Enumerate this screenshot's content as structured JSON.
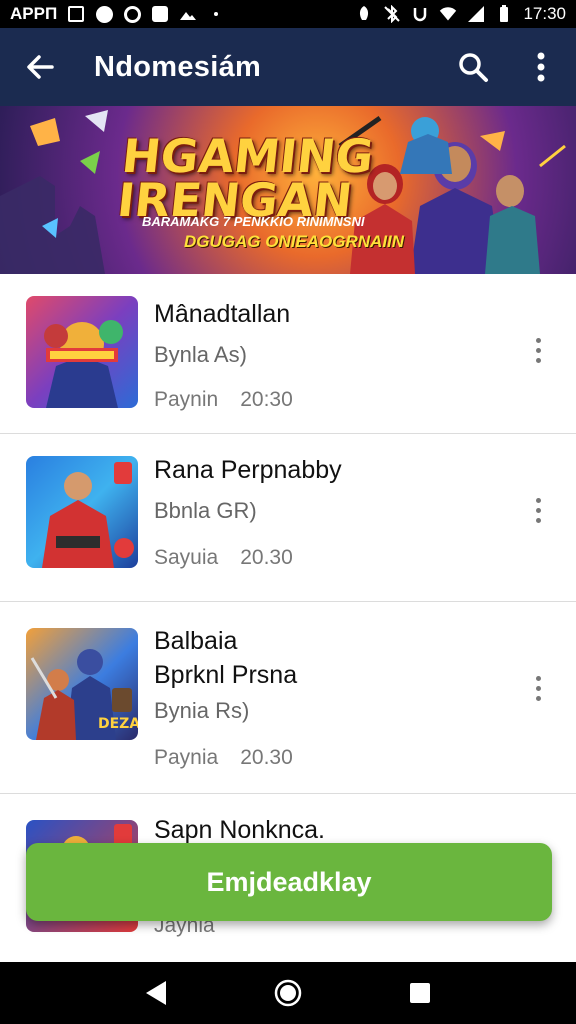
{
  "status_bar": {
    "app_label": "APPΠ",
    "time": "17:30",
    "left_icons": [
      "notification-box-icon",
      "heart-circle-icon",
      "settings-circle-icon",
      "camera-icon",
      "landscape-icon",
      "dot-icon"
    ],
    "right_icons": [
      "alarm-icon",
      "bluetooth-off-icon",
      "battery-saver-icon",
      "wifi-icon",
      "signal-icon",
      "battery-icon"
    ]
  },
  "app_bar": {
    "title": "Ndomesiám",
    "back_icon": "back-arrow-icon",
    "search_icon": "search-icon",
    "more_icon": "more-vert-icon",
    "background": "#1b2b50"
  },
  "banner": {
    "title_line1": "HGAMING",
    "title_line2": "IRENGAN",
    "subtitle1": "BARAMAKG 7 PENKKIO RINIMNSNI",
    "subtitle2": "DGUGAG ONIEAOGRNAIIN"
  },
  "items": [
    {
      "title": "Mânadtallan",
      "subtitle": "Bynla As)",
      "meta_label": "Paynin",
      "meta_time": "20:30"
    },
    {
      "title": "Rana Perpnabby",
      "subtitle": "Bbnla GR)",
      "meta_label": "Sayuia",
      "meta_time": "20.30"
    },
    {
      "title": "Balbaia\nBprknl Prsna",
      "subtitle": "Bynia Rs)",
      "meta_label": "Paynia",
      "meta_time": "20.30"
    },
    {
      "title": "Sapn Nonknca.",
      "subtitle": "",
      "meta_label": "Jaynia",
      "meta_time": ""
    }
  ],
  "action_button": {
    "label": "Emjdeadklay",
    "color": "#6ab63e"
  },
  "nav_bar": {
    "back_icon": "nav-back-icon",
    "home_icon": "nav-home-icon",
    "recents_icon": "nav-recents-icon"
  }
}
